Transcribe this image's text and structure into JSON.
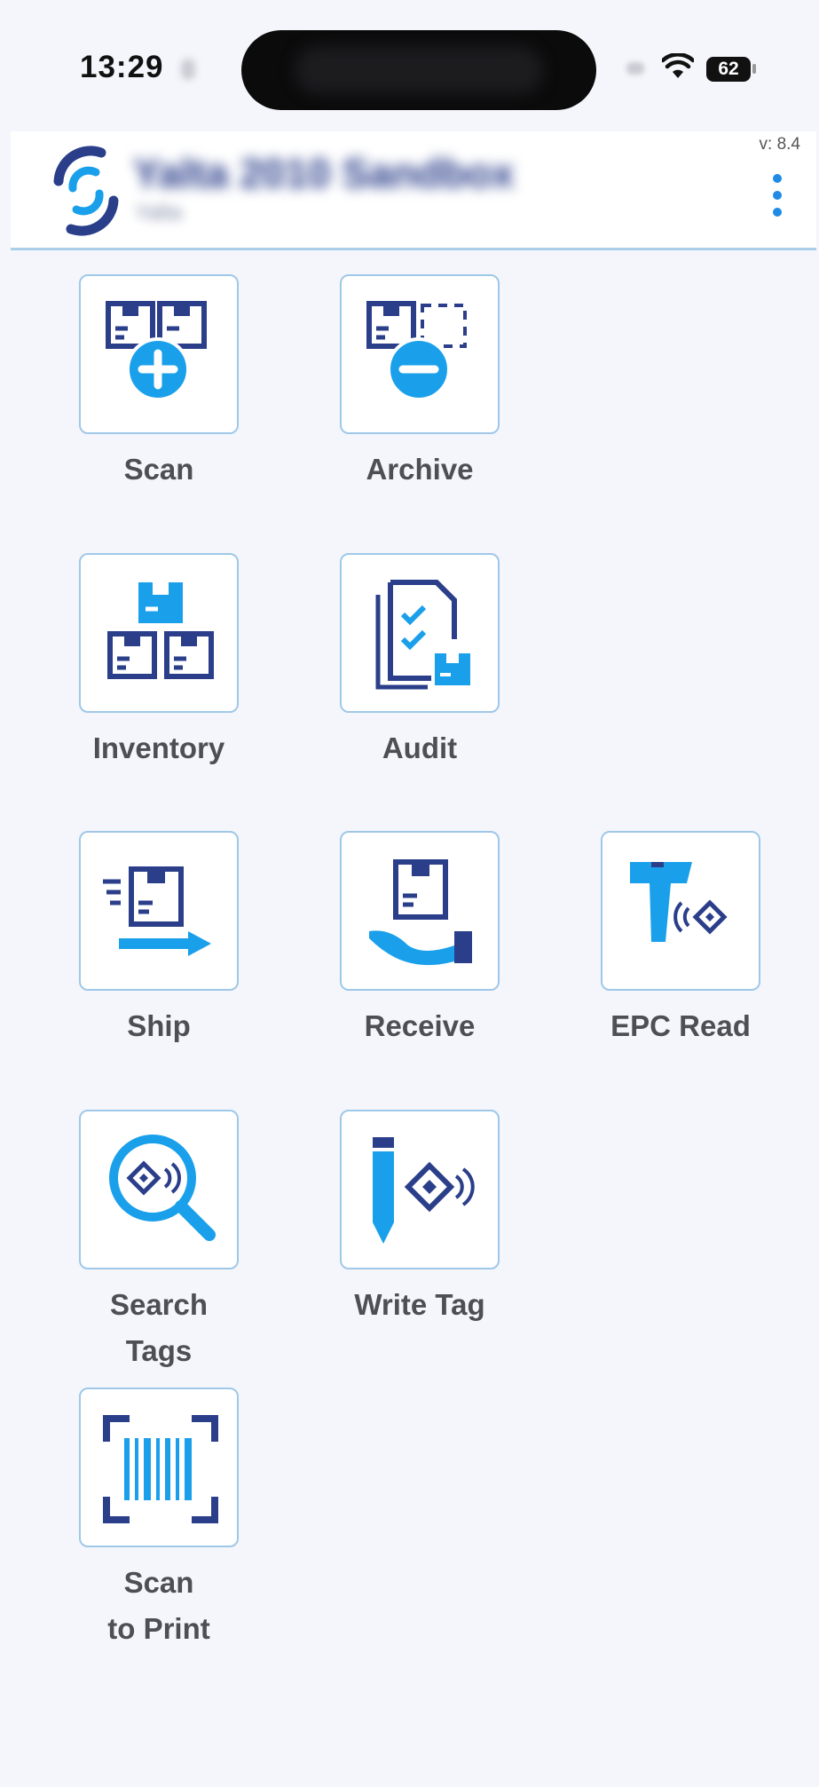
{
  "status_bar": {
    "time": "13:29",
    "battery": "62"
  },
  "header": {
    "app_title": "Yalta 2010 Sandbox",
    "app_subtitle": "Yalta",
    "version": "v: 8.4",
    "menu_icon": "more-vertical-icon"
  },
  "tiles": [
    {
      "label": "Scan",
      "icon": "scan-add-boxes-icon"
    },
    {
      "label": "Archive",
      "icon": "archive-remove-box-icon"
    },
    {
      "label": "Inventory",
      "icon": "inventory-stacked-boxes-icon"
    },
    {
      "label": "Audit",
      "icon": "audit-checklist-icon"
    },
    {
      "label": "Ship",
      "icon": "ship-box-arrow-icon"
    },
    {
      "label": "Receive",
      "icon": "receive-box-hand-icon"
    },
    {
      "label": "EPC Read",
      "icon": "rfid-reader-gun-icon"
    },
    {
      "label": "Search\nTags",
      "icon": "search-tag-magnifier-icon"
    },
    {
      "label": "Write Tag",
      "icon": "write-tag-pen-icon"
    },
    {
      "label": "Scan\nto Print",
      "icon": "barcode-scan-icon"
    }
  ],
  "colors": {
    "dark_blue": "#2a3e8a",
    "light_blue": "#1aa0ea",
    "tile_border": "#9fc8e8",
    "label": "#4d4f55"
  }
}
